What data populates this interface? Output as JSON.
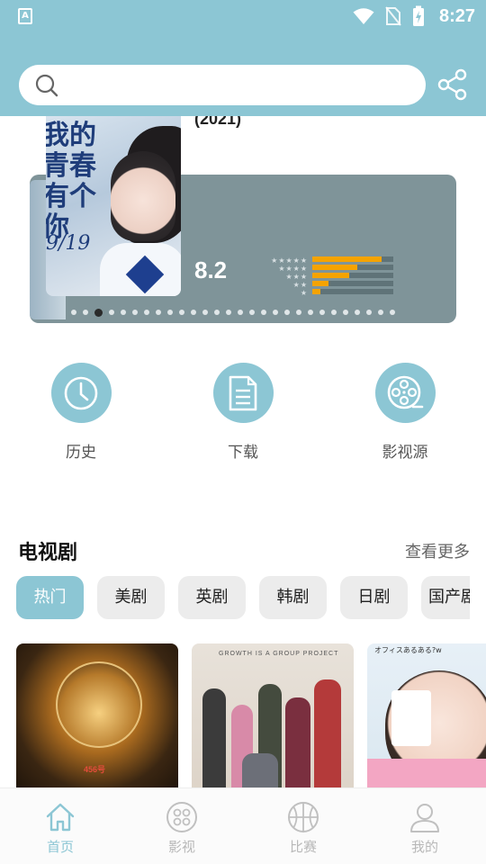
{
  "status_bar": {
    "time": "8:27",
    "app_icon_letter": "A"
  },
  "header": {
    "search_placeholder": ""
  },
  "banner": {
    "year": "(2021)",
    "poster_title": "我的青春有个你",
    "poster_date": "9/19",
    "score": "8.2",
    "rating_distribution": [
      0.85,
      0.55,
      0.45,
      0.2,
      0.1
    ],
    "dots_count": 28,
    "active_dot_index": 2
  },
  "quick_actions": [
    {
      "label": "历史",
      "icon": "clock-icon"
    },
    {
      "label": "下载",
      "icon": "document-icon"
    },
    {
      "label": "影视源",
      "icon": "film-reel-icon"
    }
  ],
  "section": {
    "title": "电视剧",
    "more": "查看更多",
    "chips": [
      "热门",
      "美剧",
      "英剧",
      "韩剧",
      "日剧",
      "国产剧"
    ],
    "active_chip": "热门"
  },
  "cards": {
    "card1_number": "456号",
    "card2_tagline": "GROWTH IS A GROUP PROJECT",
    "card3_text": "オフィスあるある?w"
  },
  "bottom_nav": [
    {
      "label": "首页",
      "icon": "home-icon",
      "active": true
    },
    {
      "label": "影视",
      "icon": "film-icon",
      "active": false
    },
    {
      "label": "比赛",
      "icon": "basketball-icon",
      "active": false
    },
    {
      "label": "我的",
      "icon": "user-icon",
      "active": false
    }
  ],
  "colors": {
    "accent": "#8cc6d4",
    "rating_bar": "#f5a300",
    "banner_bg": "#7f9499"
  }
}
